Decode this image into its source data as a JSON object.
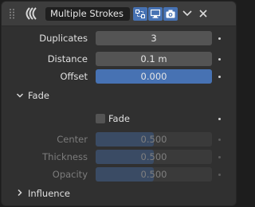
{
  "modifier": {
    "name": "Multiple Strokes",
    "icon": "multiple-strokes-icon",
    "toggles": [
      "edit-mode-icon",
      "viewport-icon",
      "render-camera-icon"
    ],
    "accent_color": "#4772b3"
  },
  "fields": {
    "duplicates": {
      "label": "Duplicates",
      "value": "3"
    },
    "distance": {
      "label": "Distance",
      "value": "0.1 m"
    },
    "offset": {
      "label": "Offset",
      "value": "0.000"
    }
  },
  "fade_panel": {
    "title": "Fade",
    "expanded": true,
    "checkbox": {
      "label": "Fade",
      "checked": false
    },
    "center": {
      "label": "Center",
      "value": "0.500",
      "fraction": 0.5
    },
    "thickness": {
      "label": "Thickness",
      "value": "0.500",
      "fraction": 0.5
    },
    "opacity": {
      "label": "Opacity",
      "value": "0.500",
      "fraction": 0.5
    }
  },
  "influence_panel": {
    "title": "Influence",
    "expanded": false
  }
}
